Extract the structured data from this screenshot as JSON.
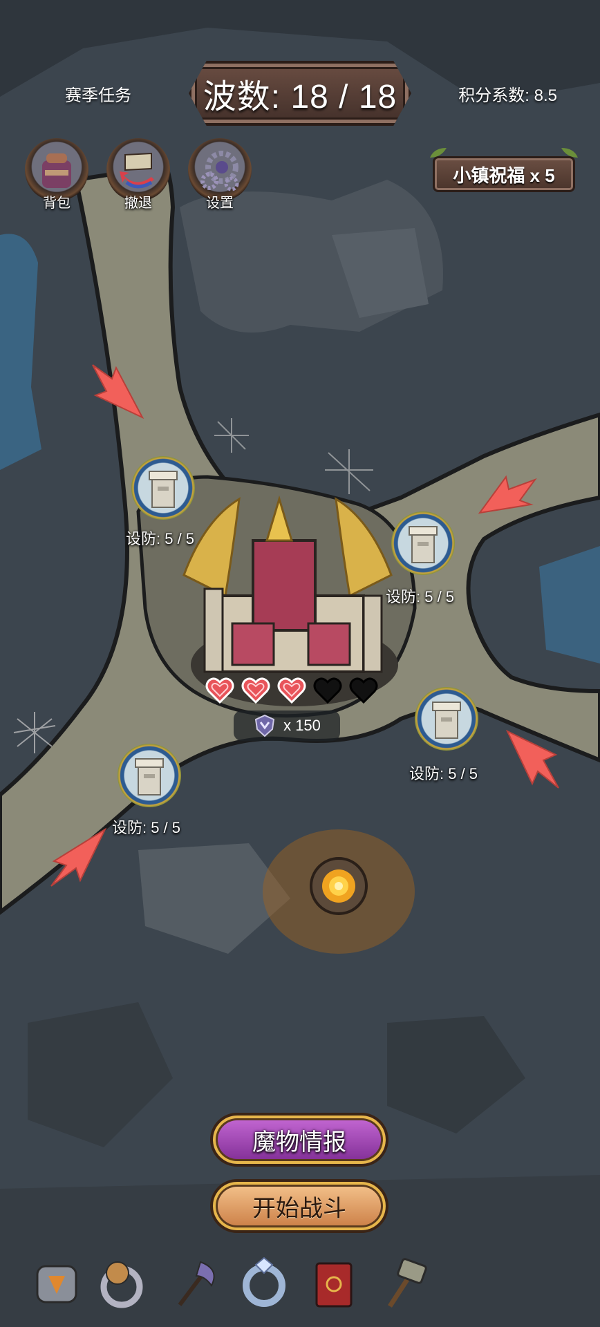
{
  "hud": {
    "season_tasks": "赛季任务",
    "wave": "波数: 18 / 18",
    "score_coef": "积分系数: 8.5"
  },
  "top_buttons": [
    {
      "label": "背包",
      "icon": "backpack-icon"
    },
    {
      "label": "撤退",
      "icon": "retreat-flag-icon"
    },
    {
      "label": "设置",
      "icon": "settings-gears-icon"
    }
  ],
  "blessing": "小镇祝福 x 5",
  "towers": [
    {
      "label": "设防: 5 / 5"
    },
    {
      "label": "设防: 5 / 5"
    },
    {
      "label": "设防: 5 / 5"
    },
    {
      "label": "设防: 5 / 5"
    }
  ],
  "base": {
    "hearts_total": 5,
    "hearts_filled": 3,
    "heart_full_color": "#e8545a",
    "heart_empty_color": "#111111",
    "trophy_count": "x 150"
  },
  "buttons": {
    "monster_intel": "魔物情报",
    "start_battle": "开始战斗"
  },
  "bottom_bar": [
    {
      "icon": "rune-stone-icon"
    },
    {
      "icon": "cookie-ring-icon"
    },
    {
      "icon": "battle-axe-icon"
    },
    {
      "icon": "crystal-ring-icon"
    },
    {
      "icon": "red-book-icon"
    },
    {
      "icon": "hammer-icon"
    }
  ],
  "colors": {
    "arrow": "#f2605a",
    "road": "#8b8a78",
    "rock": "#4a525b"
  }
}
